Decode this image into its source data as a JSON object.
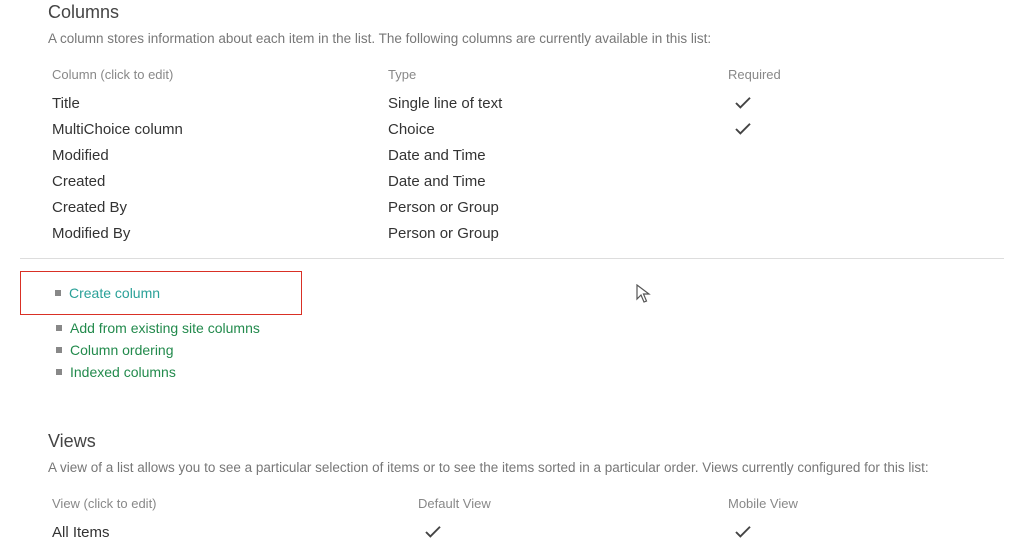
{
  "columns": {
    "heading": "Columns",
    "description": "A column stores information about each item in the list. The following columns are currently available in this list:",
    "headerName": "Column (click to edit)",
    "headerType": "Type",
    "headerRequired": "Required",
    "rows": [
      {
        "name": "Title",
        "type": "Single line of text",
        "required": true
      },
      {
        "name": "MultiChoice column",
        "type": "Choice",
        "required": true
      },
      {
        "name": "Modified",
        "type": "Date and Time",
        "required": false
      },
      {
        "name": "Created",
        "type": "Date and Time",
        "required": false
      },
      {
        "name": "Created By",
        "type": "Person or Group",
        "required": false
      },
      {
        "name": "Modified By",
        "type": "Person or Group",
        "required": false
      }
    ]
  },
  "actions": {
    "create": "Create column",
    "addExisting": "Add from existing site columns",
    "ordering": "Column ordering",
    "indexed": "Indexed columns"
  },
  "views": {
    "heading": "Views",
    "description": "A view of a list allows you to see a particular selection of items or to see the items sorted in a particular order. Views currently configured for this list:",
    "headerView": "View (click to edit)",
    "headerDefault": "Default View",
    "headerMobile": "Mobile View",
    "rows": [
      {
        "name": "All Items",
        "default": true,
        "mobile": true
      }
    ]
  }
}
